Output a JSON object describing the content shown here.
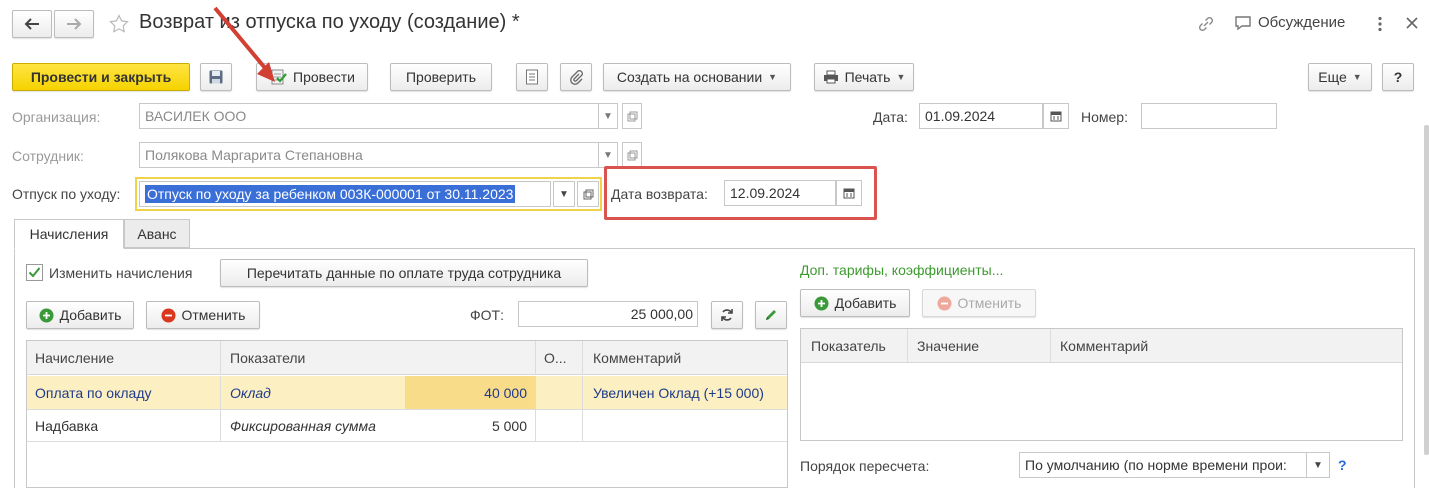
{
  "window": {
    "title": "Возврат из отпуска по уходу (создание) *",
    "discussion_label": "Обсуждение"
  },
  "toolbar": {
    "post_close_label": "Провести и закрыть",
    "post_label": "Провести",
    "check_label": "Проверить",
    "create_based_label": "Создать на основании",
    "print_label": "Печать",
    "more_label": "Еще",
    "help_label": "?"
  },
  "form": {
    "org_label": "Организация:",
    "org_value": "ВАСИЛЕК ООО",
    "employee_label": "Сотрудник:",
    "employee_value": "Полякова Маргарита Степановна",
    "leave_label": "Отпуск по уходу:",
    "leave_value": "Отпуск по уходу за ребенком 003К-000001 от 30.11.2023",
    "date_label": "Дата:",
    "date_value": "01.09.2024",
    "number_label": "Номер:",
    "number_value": "",
    "return_date_label": "Дата возврата:",
    "return_date_value": "12.09.2024"
  },
  "tabs": [
    {
      "label": "Начисления",
      "active": true
    },
    {
      "label": "Аванс",
      "active": false
    }
  ],
  "accruals": {
    "change_checkbox_label": "Изменить начисления",
    "change_checked": true,
    "reread_label": "Перечитать данные по оплате труда сотрудника",
    "add_label": "Добавить",
    "cancel_label": "Отменить",
    "fot_label": "ФОТ:",
    "fot_value": "25 000,00",
    "columns": [
      "Начисление",
      "Показатели",
      "",
      "О...",
      "Комментарий"
    ],
    "rows": [
      {
        "accrual": "Оплата по окладу",
        "indicator": "Оклад",
        "value": "40 000",
        "o": "",
        "comment": "Увеличен Оклад (+15 000)"
      },
      {
        "accrual": "Надбавка",
        "indicator": "Фиксированная сумма",
        "value": "5 000",
        "o": "",
        "comment": ""
      }
    ]
  },
  "extra": {
    "link_label": "Доп. тарифы, коэффициенты...",
    "add_label": "Добавить",
    "cancel_label": "Отменить",
    "columns": [
      "Показатель",
      "Значение",
      "Комментарий"
    ],
    "recalc_label": "Порядок пересчета:",
    "recalc_value": "По умолчанию (по норме времени прои:",
    "help": "?"
  },
  "colors": {
    "primary_yellow": "#f5d300",
    "highlight_red": "#d9534f",
    "link_green": "#3c9a2e",
    "selected_row": "#fcf0c2",
    "selection_blue": "#3a6fd8"
  }
}
